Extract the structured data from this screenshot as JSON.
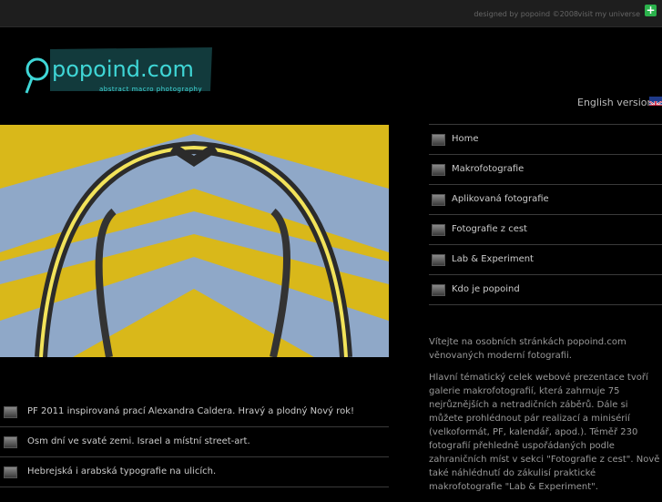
{
  "topbar": {
    "credit": "designed by popoind ©2008",
    "visit_label": "visit my universe"
  },
  "logo": {
    "wordmark": "popoind.com",
    "tagline": "abstract macro photography"
  },
  "lang": {
    "label": "English version"
  },
  "nav": {
    "items": [
      {
        "label": "Home"
      },
      {
        "label": "Makrofotografie"
      },
      {
        "label": "Aplikovaná fotografie"
      },
      {
        "label": "Fotografie z cest"
      },
      {
        "label": "Lab & Experiment"
      },
      {
        "label": "Kdo je popoind"
      }
    ]
  },
  "intro": {
    "p1": "Vítejte na osobních stránkách popoind.com věnovaných moderní fotografii.",
    "p2": "Hlavní tématický celek webové prezentace tvoří galerie makrofotografií, která zahrnuje 75 nejrůznějších a netradičních záběrů. Dále si můžete prohlédnout pár realizací a minisérií (velkoformát, PF, kalendář, apod.). Téměř 230 fotografií přehledně uspořádaných podle zahraničních míst v sekci \"Fotografie z cest\". Nově také náhlédnutí do zákulisí praktické makrofotografie \"Lab & Experiment\"."
  },
  "news": [
    {
      "text": "PF 2011 inspirovaná prací Alexandra Caldera. Hravý a plodný Nový rok!"
    },
    {
      "text": "Osm dní ve svaté zemi. Israel a místní street-art."
    },
    {
      "text": "Hebrejská i arabská typografie na ulicích."
    }
  ],
  "colors": {
    "accent_cyan": "#3fd6d6",
    "hero_yellow": "#d9b81a",
    "hero_blue": "#8fa8c8"
  }
}
